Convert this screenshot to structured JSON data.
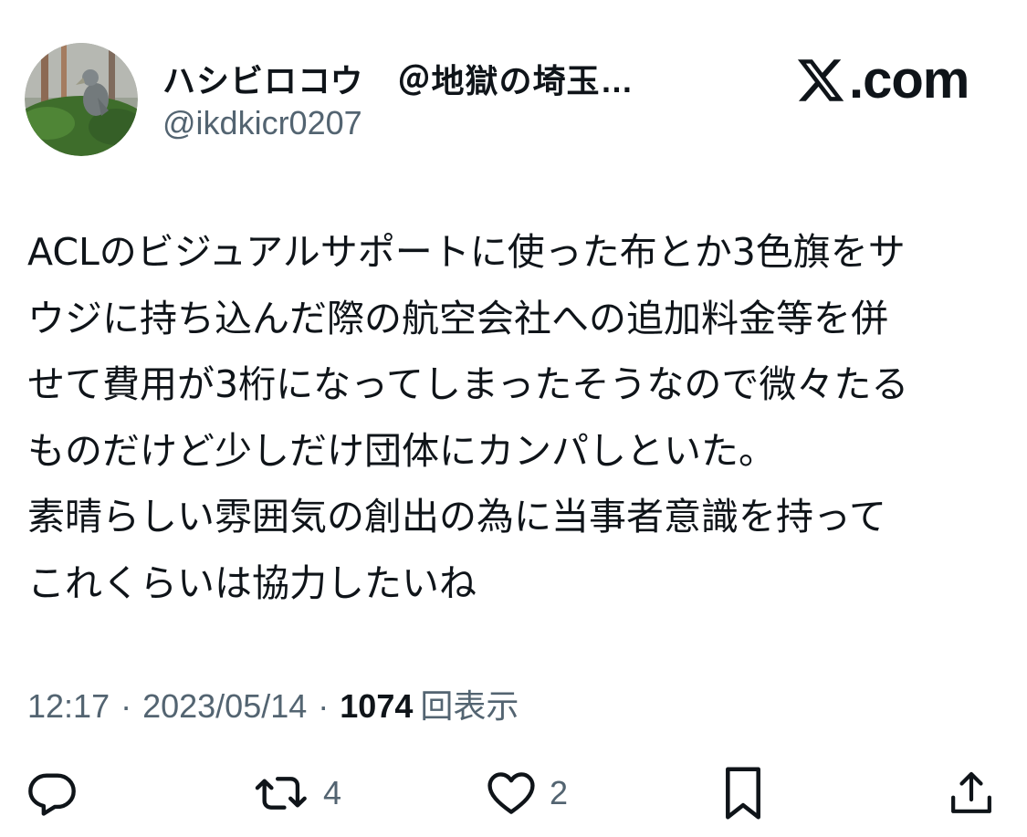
{
  "header": {
    "display_name": "ハシビロコウ　＠地獄の埼玉…",
    "handle": "@ikdkicr0207",
    "brand": ".com",
    "brand_icon": "x-logo"
  },
  "avatar": {
    "icon": "shoebill-bird-photo",
    "colors": [
      "#3f6b2e",
      "#7a8a72",
      "#b7b9b4"
    ]
  },
  "body": {
    "lines": [
      "ACLのビジュアルサポートに使った布とか3色旗をサ",
      "ウジに持ち込んだ際の航空会社への追加料金等を併",
      "せて費用が3桁になってしまったそうなので微々たる",
      "ものだけど少しだけ団体にカンパしといた。",
      "素晴らしい雰囲気の創出の為に当事者意識を持って",
      "これくらいは協力したいね"
    ]
  },
  "meta": {
    "time": "12:17",
    "separator": "·",
    "date": "2023/05/14",
    "views": "1074",
    "views_label": "回表示"
  },
  "actions": {
    "reply": {
      "icon": "reply-icon",
      "count": ""
    },
    "retweet": {
      "icon": "retweet-icon",
      "count": "4"
    },
    "like": {
      "icon": "heart-icon",
      "count": "2"
    },
    "bookmark": {
      "icon": "bookmark-icon",
      "count": ""
    },
    "share": {
      "icon": "share-icon",
      "count": ""
    }
  },
  "colors": {
    "text": "#0f1419",
    "secondary": "#536471",
    "background": "#ffffff"
  }
}
